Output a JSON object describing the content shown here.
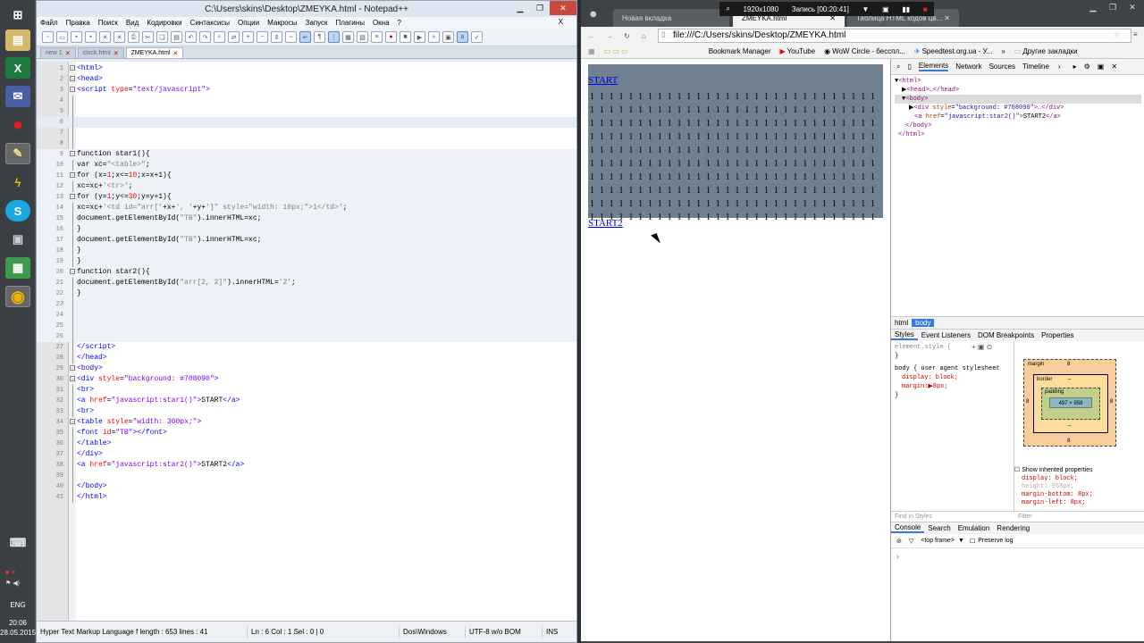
{
  "taskbar": {
    "icons": [
      "windows-start-icon",
      "folder-icon",
      "excel-icon",
      "outlook-icon",
      "opera-icon",
      "notepadpp-icon",
      "winamp-icon",
      "skype-icon",
      "explorer-icon",
      "excel2-icon",
      "chrome-icon"
    ],
    "lang": "ENG",
    "time": "20:06",
    "date": "28.05.2015"
  },
  "notepad": {
    "title": "C:\\Users\\skins\\Desktop\\ZMEYKA.html - Notepad++",
    "menu": [
      "Файл",
      "Правка",
      "Поиск",
      "Вид",
      "Кодировки",
      "Синтаксисы",
      "Опции",
      "Макросы",
      "Запуск",
      "Плагины",
      "Окна",
      "?"
    ],
    "close_x": "X",
    "tabs": [
      {
        "label": "new 1"
      },
      {
        "label": "clock.html"
      },
      {
        "label": "ZMEYKA.html"
      }
    ],
    "status": {
      "type": "Hyper Text Markup Language f length : 653    lines : 41",
      "pos": "Ln : 6    Col : 1    Sel : 0 | 0",
      "eol": "Dos\\Windows",
      "enc": "UTF-8 w/o BOM",
      "mode": "INS"
    }
  },
  "chrome": {
    "tabs": [
      "Новая вкладка",
      "ZMEYKA.html",
      "Таблица HTML кодов цв..."
    ],
    "recorder": {
      "res": "1920x1080",
      "rec": "Запись [00:20:41]"
    },
    "url": "file:///C:/Users/skins/Desktop/ZMEYKA.html",
    "bookmarks": [
      "Bookmark Manager",
      "YouTube",
      "WoW Circle - бесспл...",
      "Speedtest.org.ua - У...",
      "»",
      "Другие закладки"
    ],
    "page": {
      "start": "START",
      "start2": "START2",
      "cell": "1"
    },
    "devtools": {
      "top_tabs": [
        "Elements",
        "Network",
        "Sources",
        "Timeline"
      ],
      "bread": [
        "html",
        "body"
      ],
      "style_tabs": [
        "Styles",
        "Event Listeners",
        "DOM Breakpoints",
        "Properties"
      ],
      "styles_element": "element.style {",
      "styles_body": "body {   user agent stylesheet",
      "prop1": "display: block;",
      "prop2": "margin:▶8px;",
      "box": {
        "margin": "margin",
        "border": "border",
        "padding": "padding",
        "content": "497 × 958",
        "m": "8",
        "dash": "–"
      },
      "show_inherited": "Show inherited properties",
      "computed": [
        "display: block;",
        "height: 958px;",
        "margin-bottom: 8px;",
        "margin-left: 8px;"
      ],
      "find": "Find in Styles",
      "filter": "Filter",
      "console_tabs": [
        "Console",
        "Search",
        "Emulation",
        "Rendering"
      ],
      "top_frame": "<top frame>",
      "preserve_log": "Preserve log",
      "prompt": "›"
    }
  }
}
